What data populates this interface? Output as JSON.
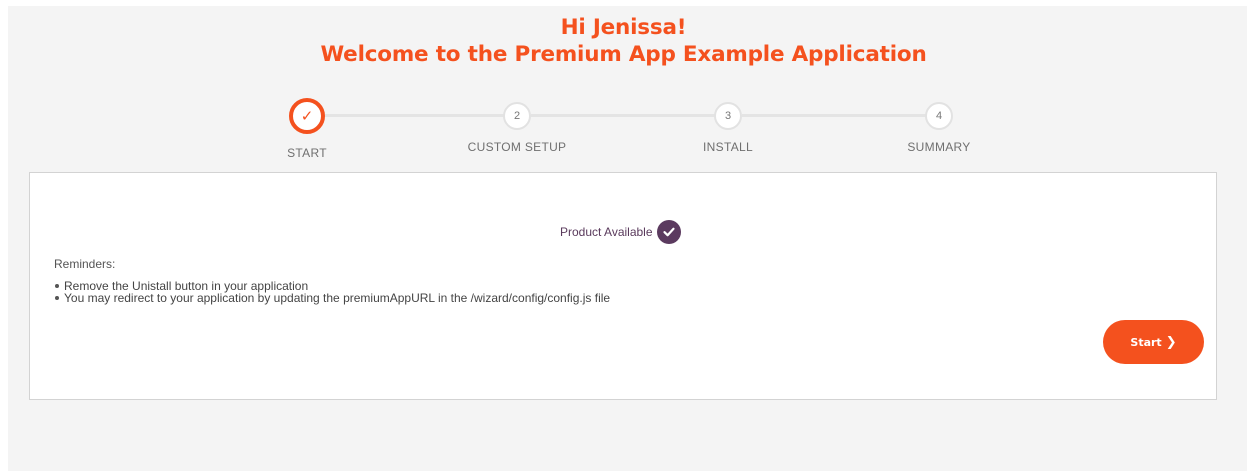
{
  "header": {
    "greeting": "Hi Jenissa!",
    "welcome": "Welcome to the Premium App Example Application"
  },
  "stepper": {
    "steps": [
      {
        "number": "1",
        "label": "START",
        "state": "completed",
        "icon": "checkmark-icon"
      },
      {
        "number": "2",
        "label": "CUSTOM SETUP",
        "state": "pending"
      },
      {
        "number": "3",
        "label": "INSTALL",
        "state": "pending"
      },
      {
        "number": "4",
        "label": "SUMMARY",
        "state": "pending"
      }
    ]
  },
  "card": {
    "product_status": "Product Available",
    "product_status_icon": "check-circle-icon",
    "reminders_title": "Reminders:",
    "reminders": [
      "Remove the Unistall button in your application",
      "You may redirect to your application by updating the premiumAppURL in the /wizard/config/config.js file"
    ],
    "start_button": {
      "label": "Start",
      "icon": "chevron-right-icon"
    }
  },
  "colors": {
    "accent": "#f4511e",
    "badge": "#5b3a5f",
    "background": "#f4f4f4",
    "card_border": "#d3d3d3"
  }
}
